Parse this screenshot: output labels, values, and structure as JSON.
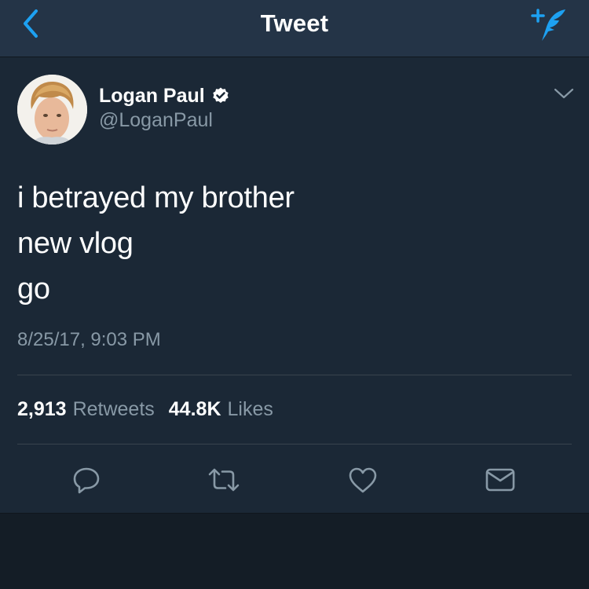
{
  "navbar": {
    "title": "Tweet",
    "back_icon": "chevron-left-icon",
    "compose_icon": "compose-feather-icon",
    "accent_color": "#1da1f2"
  },
  "tweet": {
    "author": {
      "name": "Logan Paul",
      "handle": "@LoganPaul",
      "verified": true,
      "avatar_icon": "profile-photo"
    },
    "lines": [
      "i betrayed my brother",
      "new vlog",
      "go"
    ],
    "timestamp": "8/25/17, 9:03 PM",
    "stats": {
      "retweets_count": "2,913",
      "retweets_label": "Retweets",
      "likes_count": "44.8K",
      "likes_label": "Likes"
    },
    "actions": [
      "reply-icon",
      "retweet-icon",
      "like-icon",
      "direct-message-icon"
    ]
  },
  "colors": {
    "background": "#141d26",
    "panel": "#1b2836",
    "navbar": "#243447",
    "secondary_text": "#8899a6",
    "primary_text": "#ffffff"
  }
}
